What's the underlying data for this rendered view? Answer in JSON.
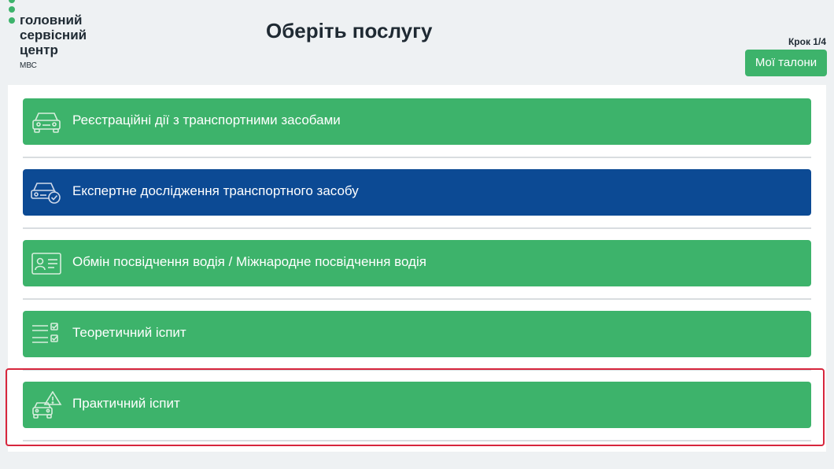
{
  "logo": {
    "line1": "головний",
    "line2": "сервісний",
    "line3": "центр",
    "sub": "МВС"
  },
  "header": {
    "title": "Оберіть послугу",
    "step": "Крок 1/4",
    "tickets_button": "Мої талони"
  },
  "services": [
    {
      "label": "Реєстраційні дії з транспортними засобами",
      "icon": "car-icon",
      "color": "#3db36b"
    },
    {
      "label": "Експертне дослідження транспортного засобу",
      "icon": "car-inspection-icon",
      "color": "#0c4a94"
    },
    {
      "label": "Обмін посвідчення водія / Міжнародне посвідчення водія",
      "icon": "id-card-icon",
      "color": "#3db36b"
    },
    {
      "label": "Теоретичний іспит",
      "icon": "checklist-icon",
      "color": "#3db36b"
    },
    {
      "label": "Практичний іспит",
      "icon": "car-warning-icon",
      "color": "#3db36b"
    }
  ],
  "colors": {
    "accent_green": "#3db36b",
    "accent_blue": "#0c4a94",
    "highlight_red": "#d7263d"
  }
}
